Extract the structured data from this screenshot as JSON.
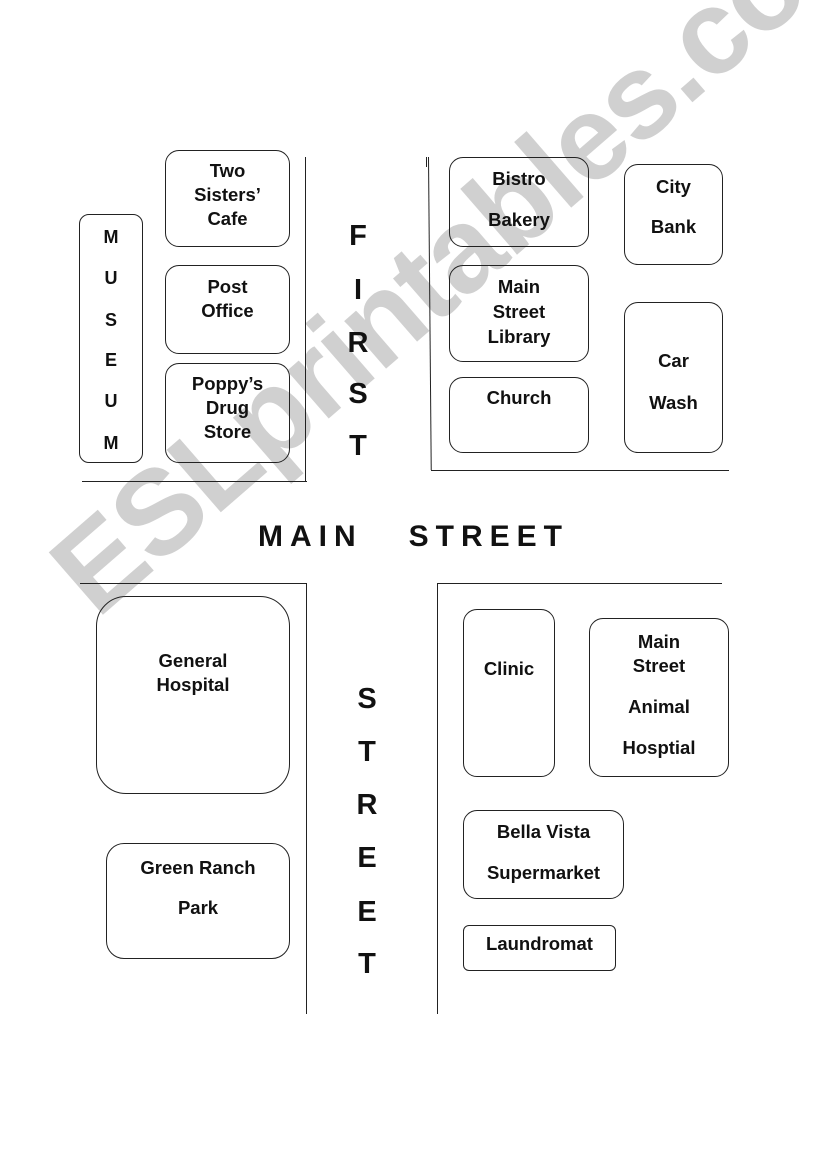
{
  "streets": {
    "main": "MAIN   STREET",
    "first_letters": [
      "F",
      "I",
      "R",
      "S",
      "T"
    ],
    "street_letters": [
      "S",
      "T",
      "R",
      "E",
      "E",
      "T"
    ]
  },
  "buildings": {
    "museum_letters": [
      "M",
      "U",
      "S",
      "E",
      "U",
      "M"
    ],
    "two_sisters_cafe": [
      "Two",
      "Sisters’",
      "Cafe"
    ],
    "post_office": [
      "Post",
      "Office"
    ],
    "poppys_drug_store": [
      "Poppy’s",
      "Drug",
      "Store"
    ],
    "bistro_bakery": [
      "Bistro",
      "Bakery"
    ],
    "city_bank": [
      "City",
      "Bank"
    ],
    "main_street_library": [
      "Main",
      "Street",
      "Library"
    ],
    "church": [
      "Church"
    ],
    "car_wash": [
      "Car",
      "Wash"
    ],
    "general_hospital": [
      "General",
      "Hospital"
    ],
    "green_ranch_park": [
      "Green Ranch",
      "Park"
    ],
    "clinic": [
      "Clinic"
    ],
    "animal_hospital": [
      "Main",
      "Street",
      "Animal",
      "Hosptial"
    ],
    "bella_vista_supermarket": [
      "Bella Vista",
      "Supermarket"
    ],
    "laundromat": [
      "Laundromat"
    ]
  },
  "watermark": "ESLprintables.com"
}
